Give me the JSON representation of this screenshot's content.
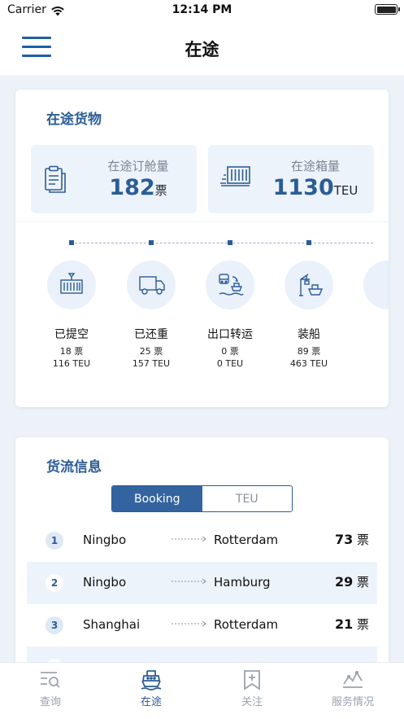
{
  "status_bar": {
    "carrier": "Carrier",
    "time": "12:14 PM"
  },
  "nav": {
    "title": "在途"
  },
  "in_transit": {
    "title": "在途货物",
    "bookings": {
      "label": "在途订舱量",
      "value": "182",
      "unit": "票"
    },
    "containers": {
      "label": "在途箱量",
      "value": "1130",
      "unit": "TEU"
    },
    "stages": [
      {
        "name": "已提空",
        "tickets": "18 票",
        "teu": "116 TEU",
        "icon": "container-icon"
      },
      {
        "name": "已还重",
        "tickets": "25 票",
        "teu": "157 TEU",
        "icon": "truck-icon"
      },
      {
        "name": "出口转运",
        "tickets": "0 票",
        "teu": "0 TEU",
        "icon": "transship-icon"
      },
      {
        "name": "装船",
        "tickets": "89 票",
        "teu": "463 TEU",
        "icon": "crane-ship-icon"
      }
    ]
  },
  "flow": {
    "title": "货流信息",
    "segments": {
      "booking": "Booking",
      "teu": "TEU",
      "selected": "Booking"
    },
    "routes": [
      {
        "rank": "1",
        "origin": "Ningbo",
        "destination": "Rotterdam",
        "count": "73",
        "unit": "票"
      },
      {
        "rank": "2",
        "origin": "Ningbo",
        "destination": "Hamburg",
        "count": "29",
        "unit": "票"
      },
      {
        "rank": "3",
        "origin": "Shanghai",
        "destination": "Rotterdam",
        "count": "21",
        "unit": "票"
      }
    ]
  },
  "tabs": [
    {
      "label": "查询",
      "icon": "search-list-icon"
    },
    {
      "label": "在途",
      "icon": "ship-icon",
      "active": true
    },
    {
      "label": "关注",
      "icon": "bookmark-plus-icon"
    },
    {
      "label": "服务情况",
      "icon": "service-chart-icon"
    }
  ],
  "colors": {
    "accent": "#2b5c96",
    "tile_bg": "#edf3fb",
    "page_bg": "#edf2f9",
    "inactive": "#9aa3ae"
  }
}
